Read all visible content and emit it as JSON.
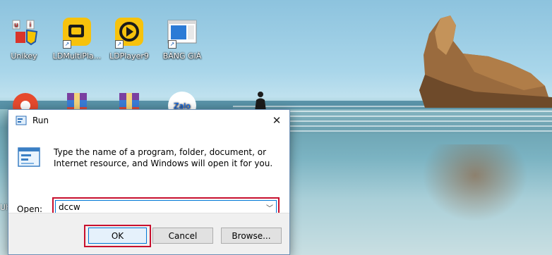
{
  "desktop": {
    "icons": [
      {
        "label": "Unikey"
      },
      {
        "label": "LDMultiPla..."
      },
      {
        "label": "LDPlayer9"
      },
      {
        "label": "BẢNG GIÁ"
      },
      {
        "label": "Zalo"
      }
    ],
    "partial_label": "Uh"
  },
  "run_dialog": {
    "title": "Run",
    "close_glyph": "✕",
    "description": "Type the name of a program, folder, document, or Internet resource, and Windows will open it for you.",
    "open_label": "Open:",
    "open_value": "dccw",
    "buttons": {
      "ok": "OK",
      "cancel": "Cancel",
      "browse": "Browse..."
    },
    "highlight_color": "#c8102e"
  }
}
